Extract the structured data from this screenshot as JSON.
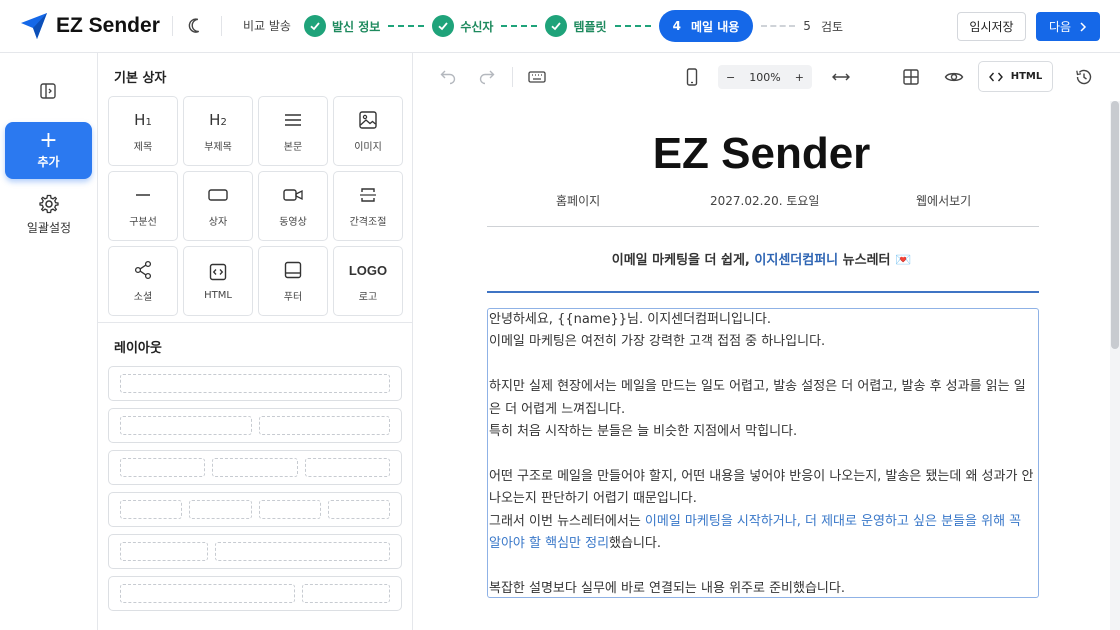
{
  "app": {
    "name": "EZ Sender"
  },
  "header": {
    "compare_label": "비교 발송",
    "steps": [
      {
        "label": "발신 정보",
        "state": "done"
      },
      {
        "label": "수신자",
        "state": "done"
      },
      {
        "label": "템플릿",
        "state": "done"
      },
      {
        "number": "4",
        "label": "메일 내용",
        "state": "active"
      },
      {
        "number": "5",
        "label": "검토",
        "state": "todo"
      }
    ],
    "save_label": "임시저장",
    "next_label": "다음"
  },
  "rail": {
    "add_label": "추가",
    "settings_label": "일괄설정"
  },
  "panel": {
    "basic_title": "기본 상자",
    "tiles": [
      {
        "icon": "heading-1-icon",
        "glyph": "H1",
        "label": "제목"
      },
      {
        "icon": "heading-2-icon",
        "glyph": "H2",
        "label": "부제목"
      },
      {
        "icon": "text-lines-icon",
        "label": "본문"
      },
      {
        "icon": "image-icon",
        "label": "이미지"
      },
      {
        "icon": "divider-icon",
        "label": "구분선"
      },
      {
        "icon": "box-icon",
        "label": "상자"
      },
      {
        "icon": "video-icon",
        "label": "동영상"
      },
      {
        "icon": "spacing-icon",
        "label": "간격조절"
      },
      {
        "icon": "share-icon",
        "label": "소셜"
      },
      {
        "icon": "code-icon",
        "label": "HTML"
      },
      {
        "icon": "footer-icon",
        "label": "푸터"
      },
      {
        "icon": "logo-icon",
        "glyph": "LOGO",
        "label": "로고"
      }
    ],
    "layout_title": "레이아웃"
  },
  "toolbar": {
    "zoom": "100%",
    "html_label": "HTML"
  },
  "newsletter": {
    "title": "EZ Sender",
    "meta": {
      "home": "홈페이지",
      "date": "2027.02.20. 토요일",
      "web": "웹에서보기"
    },
    "tagline_pre": "이메일 마케팅을 더 쉽게, ",
    "tagline_company": "이지센더컴퍼니",
    "tagline_post": " 뉴스레터 💌",
    "body": {
      "l1": "안녕하세요, {{name}}님. 이지센더컴퍼니입니다.",
      "l2": "이메일 마케팅은 여전히 가장 강력한 고객 접점 중 하나입니다.",
      "l3": "하지만 실제 현장에서는 메일을 만드는 일도 어렵고, 발송 설정은 더 어렵고, 발송 후 성과를 읽는 일은 더 어렵게 느껴집니다.",
      "l4": "특히 처음 시작하는 분들은 늘 비슷한 지점에서 막힙니다.",
      "l5": "어떤 구조로 메일을 만들어야 할지, 어떤 내용을 넣어야 반응이 나오는지, 발송은 됐는데 왜 성과가 안 나오는지 판단하기 어렵기 때문입니다.",
      "l6_pre": "그래서 이번 뉴스레터에서는 ",
      "l6_link": "이메일 마케팅을 시작하거나, 더 제대로 운영하고 싶은 분들을 위해 꼭 알아야 할 핵심만 정리",
      "l6_post": "했습니다.",
      "l7": "복잡한 설명보다 실무에 바로 연결되는 내용 위주로 준비했습니다."
    }
  },
  "colors": {
    "primary": "#1568e8",
    "success": "#1fa37a",
    "link": "#3a78c9"
  }
}
